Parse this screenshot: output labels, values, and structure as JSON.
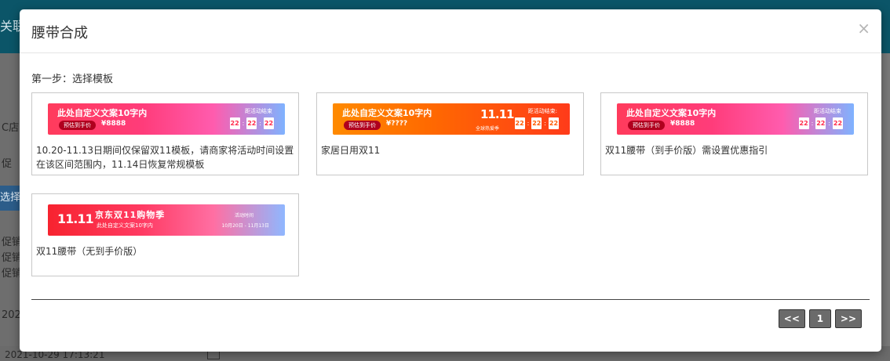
{
  "background": {
    "top_text": "关联",
    "side_texts": [
      "C店",
      "促",
      "选择",
      "促销",
      "促销",
      "促销",
      "202"
    ],
    "bottom_text": "2021-10-29 17:13:21"
  },
  "modal": {
    "title": "腰带合成",
    "close_glyph": "×",
    "step_label": "第一步：选择模板"
  },
  "templates": [
    {
      "style": "pink",
      "banner": {
        "title": "此处自定义文案10字内",
        "price_pill": "预估到手价",
        "price": "¥8888",
        "countdown_label": "距活动结束",
        "countdown": [
          "22",
          "22",
          "22"
        ]
      },
      "description": "10.20-11.13日期间仅保留双11模板，请商家将活动时间设置在该区间范围内，11.14日恢复常规模板"
    },
    {
      "style": "orange",
      "banner": {
        "title": "此处自定义文案10字内",
        "price_pill": "预估到手价",
        "price": "¥????",
        "logo": "11.11",
        "logo_sub": "全球热爱季",
        "countdown_label": "距活动结束:",
        "countdown": [
          "22",
          "22",
          "22"
        ]
      },
      "description": "家居日用双11"
    },
    {
      "style": "pink",
      "banner": {
        "title": "此处自定义文案10字内",
        "price_pill": "预估到手价",
        "price": "¥8888",
        "countdown_label": "距活动结束",
        "countdown": [
          "22",
          "22",
          "22"
        ]
      },
      "description": "双11腰带（到手价版）需设置优惠指引"
    },
    {
      "style": "jd",
      "banner": {
        "logo": "11.11",
        "title": "京东双11购物季",
        "subtitle": "此处自定义文案10字内",
        "time_label": "活动时间",
        "time": "10月20日 - 11月13日"
      },
      "description": "双11腰带（无到手价版）"
    }
  ],
  "pagination": {
    "prev": "<<",
    "current": "1",
    "next": ">>"
  }
}
